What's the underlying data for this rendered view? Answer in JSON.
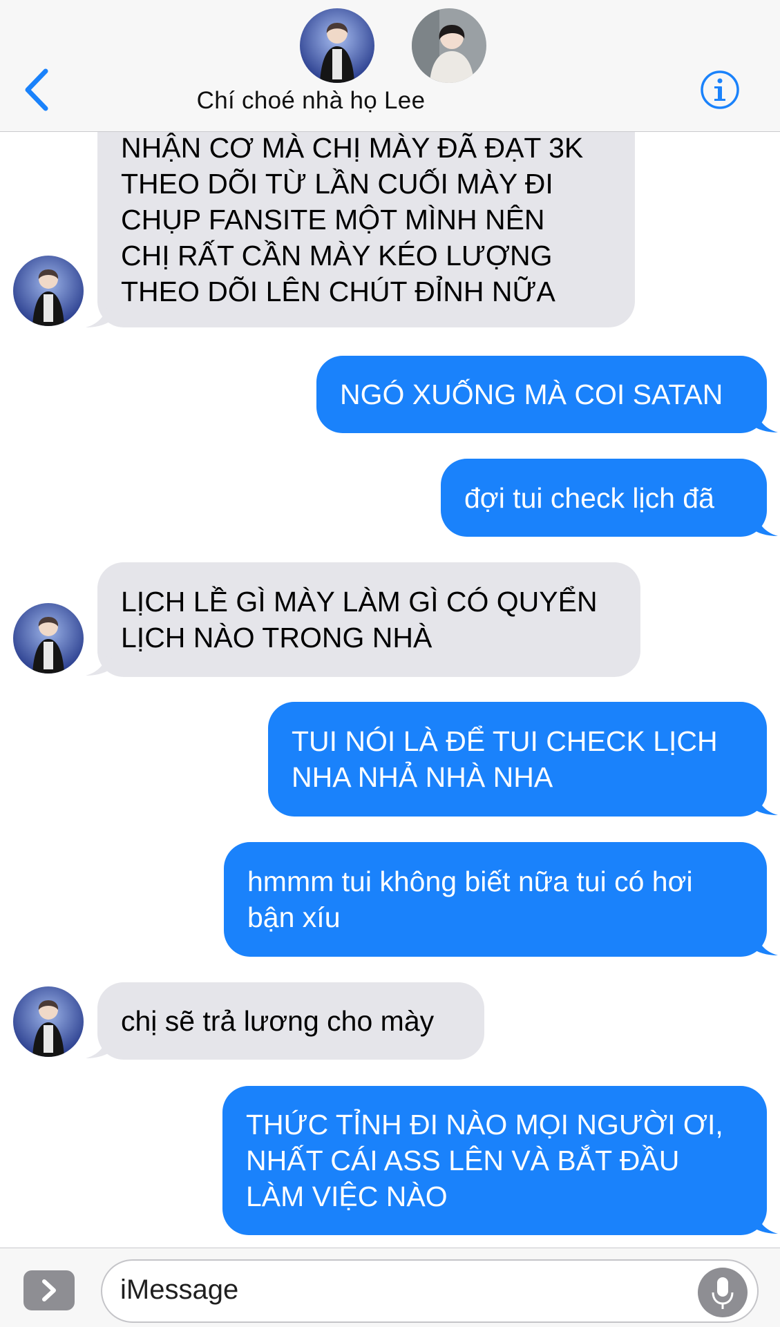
{
  "header": {
    "title": "Chí choé nhà họ Lee",
    "accent": "#1a82fb"
  },
  "messages": [
    {
      "side": "in",
      "text": "NHẬN CƠ MÀ CHỊ MÀY ĐÃ ĐẠT 3K\nTHEO DÕI TỪ LẦN CUỐI MÀY ĐI\nCHỤP FANSITE MỘT MÌNH NÊN\nCHỊ RẤT CẦN MÀY KÉO LƯỢNG\nTHEO DÕI LÊN CHÚT ĐỈNH NỮA"
    },
    {
      "side": "out",
      "text": "NGÓ XUỐNG MÀ COI SATAN"
    },
    {
      "side": "out",
      "text": "đợi tui check lịch đã"
    },
    {
      "side": "in",
      "text": "LỊCH LỀ GÌ MÀY LÀM GÌ CÓ QUYỂN\nLỊCH NÀO TRONG NHÀ"
    },
    {
      "side": "out",
      "text": "TUI NÓI LÀ ĐỂ TUI CHECK LỊCH\nNHA NHẢ NHÀ NHA"
    },
    {
      "side": "out",
      "text": "hmmm tui không biết nữa tui có hơi\nbận xíu"
    },
    {
      "side": "in",
      "text": "chị sẽ trả lương cho mày"
    },
    {
      "side": "out",
      "text": "THỨC TỈNH ĐI NÀO MỌI NGƯỜI ƠI,\nNHẤT CÁI ASS LÊN VÀ BẮT ĐẦU\nLÀM VIỆC NÀO"
    }
  ],
  "input": {
    "placeholder": "iMessage"
  },
  "colors": {
    "incoming_bubble": "#e5e5ea",
    "outgoing_bubble": "#1a82fb"
  }
}
